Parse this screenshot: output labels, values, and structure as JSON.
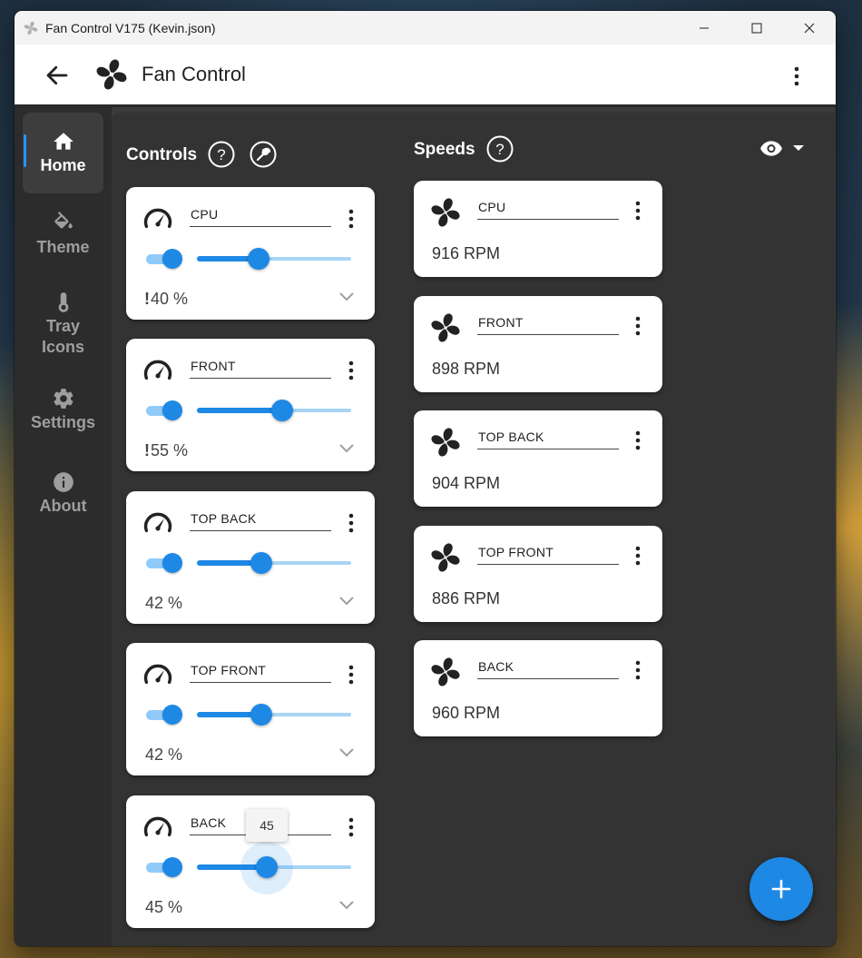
{
  "window": {
    "title": "Fan Control V175 (Kevin.json)",
    "buttons": [
      "minimize-icon",
      "maximize-icon",
      "close-icon"
    ]
  },
  "appbar": {
    "title": "Fan Control"
  },
  "nav": [
    {
      "label": "Home",
      "icon": "home-icon",
      "active": true
    },
    {
      "label": "Theme",
      "icon": "paint-bucket-icon",
      "active": false
    },
    {
      "label": "Tray Icons",
      "icon": "thermometer-icon",
      "active": false
    },
    {
      "label": "Settings",
      "icon": "gear-icon",
      "active": false
    },
    {
      "label": "About",
      "icon": "info-icon",
      "active": false
    }
  ],
  "controls": {
    "title": "Controls",
    "cards": [
      {
        "name": "CPU",
        "percent_text": "40 %",
        "value": 40,
        "warn": "!",
        "enabled": true
      },
      {
        "name": "FRONT",
        "percent_text": "55 %",
        "value": 55,
        "warn": "!",
        "enabled": true
      },
      {
        "name": "TOP BACK",
        "percent_text": "42 %",
        "value": 42,
        "warn": "",
        "enabled": true
      },
      {
        "name": "TOP FRONT",
        "percent_text": "42 %",
        "value": 42,
        "warn": "",
        "enabled": true
      },
      {
        "name": "BACK",
        "percent_text": "45 %",
        "value": 45,
        "warn": "",
        "enabled": true,
        "tooltip": "45"
      }
    ]
  },
  "speeds": {
    "title": "Speeds",
    "cards": [
      {
        "name": "CPU",
        "rpm_text": "916 RPM"
      },
      {
        "name": "FRONT",
        "rpm_text": "898 RPM"
      },
      {
        "name": "TOP BACK",
        "rpm_text": "904 RPM"
      },
      {
        "name": "TOP FRONT",
        "rpm_text": "886 RPM"
      },
      {
        "name": "BACK",
        "rpm_text": "960 RPM"
      }
    ]
  },
  "colors": {
    "accent": "#1e88e5",
    "track_light": "#a8d4f5",
    "panel": "#333333",
    "sidebar": "#2c2c2c"
  }
}
